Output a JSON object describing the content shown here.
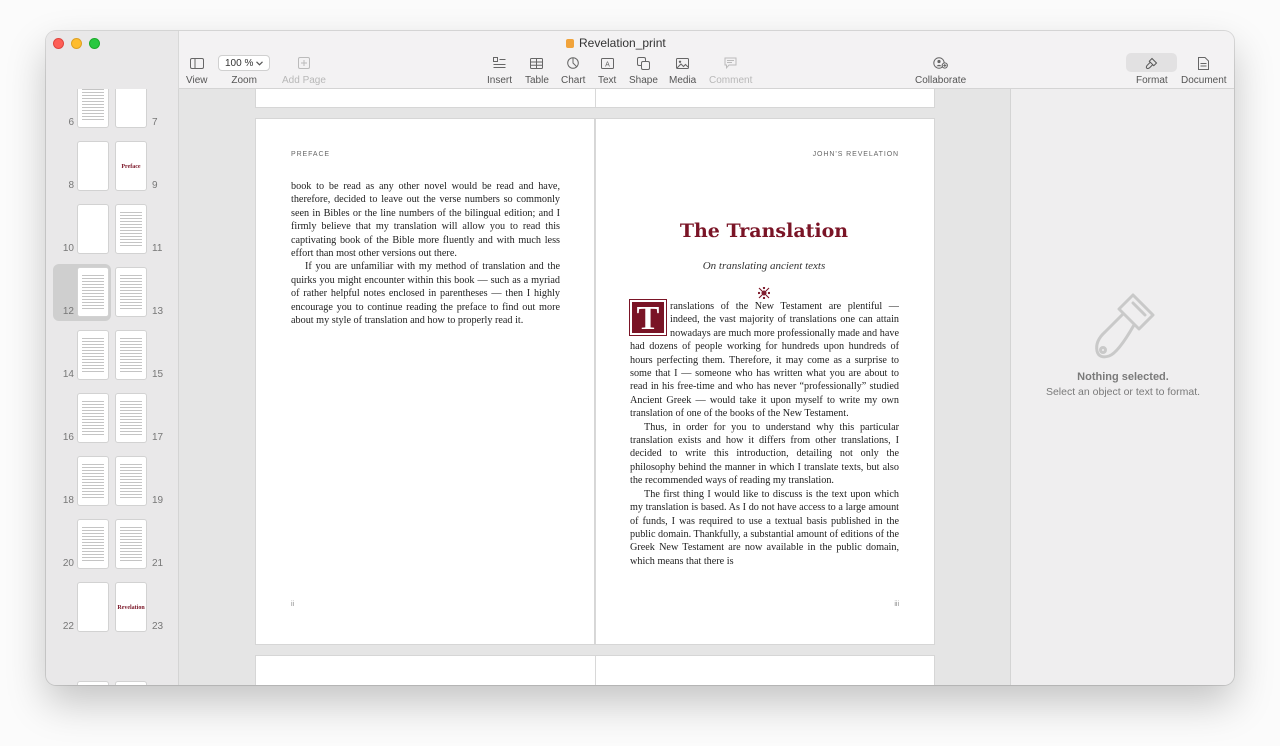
{
  "window": {
    "title": "Revelation_print"
  },
  "toolbar": {
    "view_label": "View",
    "zoom_value": "100 %",
    "zoom_label": "Zoom",
    "add_page_label": "Add Page",
    "insert_label": "Insert",
    "table_label": "Table",
    "chart_label": "Chart",
    "text_label": "Text",
    "shape_label": "Shape",
    "media_label": "Media",
    "comment_label": "Comment",
    "collaborate_label": "Collaborate",
    "format_label": "Format",
    "document_label": "Document"
  },
  "sidebar": {
    "rows": [
      {
        "left": "6",
        "right": "7",
        "left_kind": "lines",
        "right_kind": "blank"
      },
      {
        "left": "8",
        "right": "9",
        "left_kind": "blank",
        "right_kind": "title",
        "right_title": "Preface"
      },
      {
        "left": "10",
        "right": "11",
        "left_kind": "blank",
        "right_kind": "lines"
      },
      {
        "left": "12",
        "right": "13",
        "left_kind": "lines",
        "right_kind": "lines",
        "selected": true
      },
      {
        "left": "14",
        "right": "15",
        "left_kind": "lines",
        "right_kind": "lines"
      },
      {
        "left": "16",
        "right": "17",
        "left_kind": "lines",
        "right_kind": "lines"
      },
      {
        "left": "18",
        "right": "19",
        "left_kind": "lines",
        "right_kind": "lines"
      },
      {
        "left": "20",
        "right": "21",
        "left_kind": "lines",
        "right_kind": "lines"
      },
      {
        "left": "22",
        "right": "23",
        "left_kind": "blank",
        "right_kind": "title",
        "right_title": "Revelation"
      }
    ]
  },
  "left_page": {
    "running_head": "PREFACE",
    "paragraph1": "book to be read as any other novel would be read and have, therefore, decided to leave out the verse numbers so commonly seen in Bibles or the line numbers of the bilingual edition; and I firmly believe that my translation will allow you to read this captivating book of the Bible more fluently and with much less effort than most other versions out there.",
    "paragraph2": "If you are unfamiliar with my method of translation and the quirks you might encounter within this book — such as a myriad of rather helpful notes enclosed in parentheses — then I highly encourage you to continue reading the preface to find out more about my style of translation and how to properly read it.",
    "folio": "ii"
  },
  "right_page": {
    "running_head": "JOHN’S REVELATION",
    "title": "The Translation",
    "subtitle": "On translating ancient texts",
    "drop_cap": "T",
    "paragraph1": "ranslations of the New Testament are plentiful — indeed, the vast majority of translations one can attain nowadays are much more professionally made and have had dozens of people working for hundreds upon hundreds of hours perfecting them. Therefore, it may come as a surprise to some that I — someone who has written what you are about to read in his free-time and who has never “professionally” studied Ancient Greek — would take it upon myself to write my own translation of one of the books of the New Testament.",
    "paragraph2": "Thus, in order for you to understand why this particular translation exists and how it differs from other translations, I decided to write this introduction, detailing not only the philosophy behind the manner in which I translate texts, but also the recommended ways of reading my translation.",
    "paragraph3": "The first thing I would like to discuss is the text upon which my translation is based. As I do not have access to a large amount of funds, I was required to use a textual basis published in the public domain. Thankfully, a substantial amount of editions of the Greek New Testament are now available in the public domain, which means that there is",
    "folio": "iii"
  },
  "inspector": {
    "title": "Nothing selected.",
    "subtitle": "Select an object or text to format."
  },
  "colors": {
    "accent_red": "#7a1426"
  }
}
